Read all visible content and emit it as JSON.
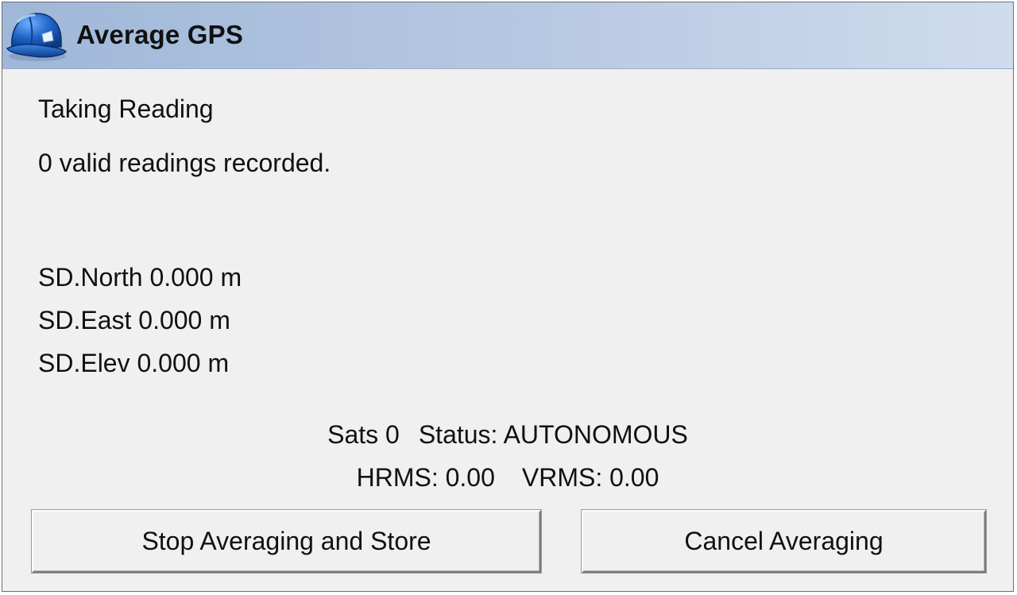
{
  "window": {
    "title": "Average GPS",
    "icon": "hard-hat-icon"
  },
  "reading": {
    "state": "Taking Reading",
    "count_text": "0 valid readings recorded."
  },
  "deviation": {
    "north": "SD.North 0.000 m",
    "east": "SD.East 0.000 m",
    "elev": "SD.Elev 0.000 m"
  },
  "gps_status": {
    "sats": "Sats 0",
    "status": "Status: AUTONOMOUS",
    "hrms": "HRMS: 0.00",
    "vrms": "VRMS: 0.00"
  },
  "buttons": {
    "stop_store": "Stop Averaging and Store",
    "cancel": "Cancel Averaging"
  },
  "colors": {
    "titlebar_start": "#9fb7d8",
    "titlebar_end": "#cfdcee",
    "background": "#f0f0f0",
    "icon_blue": "#1f63c6"
  }
}
